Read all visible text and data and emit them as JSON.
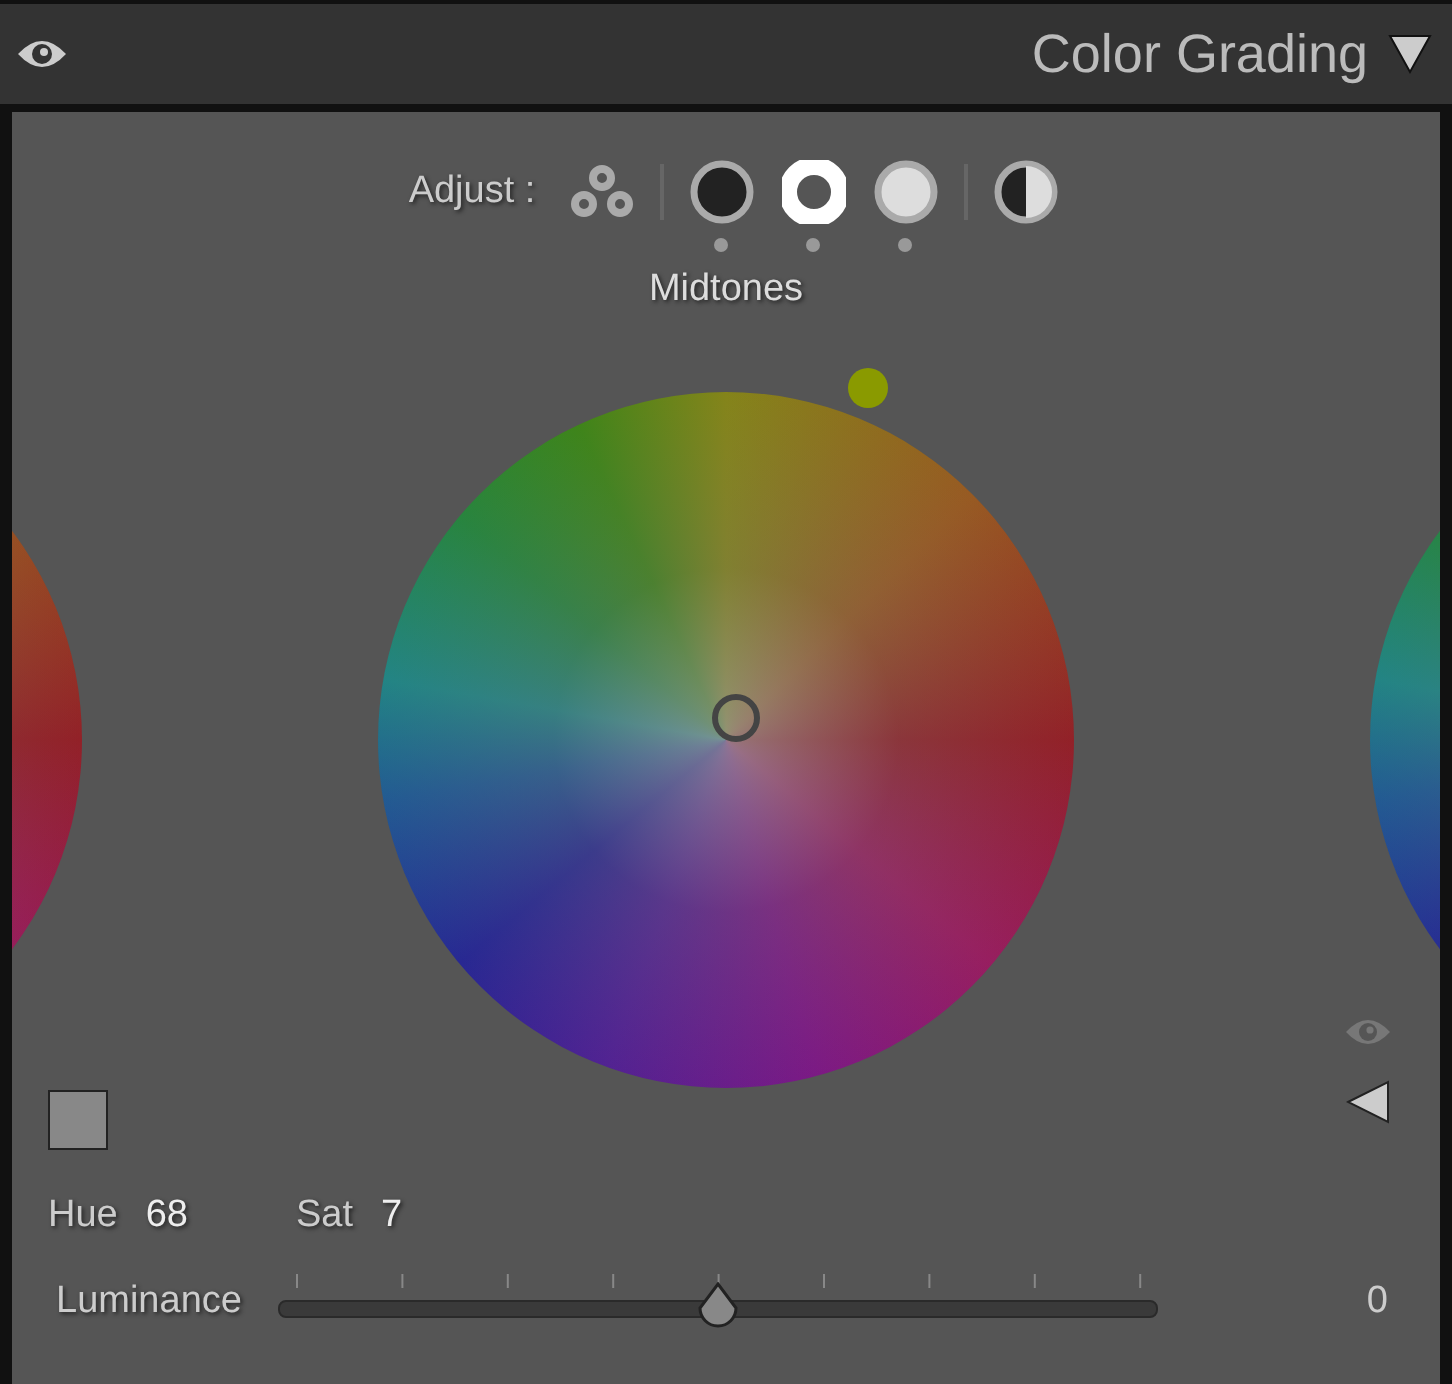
{
  "panel": {
    "title": "Color Grading",
    "expanded": true
  },
  "adjust": {
    "label": "Adjust :",
    "modes": [
      {
        "kind": "all",
        "selected": false
      },
      {
        "kind": "shadows",
        "selected": false
      },
      {
        "kind": "midtones",
        "selected": true
      },
      {
        "kind": "highlights",
        "selected": false
      },
      {
        "kind": "global",
        "selected": false
      }
    ]
  },
  "mode_label": "Midtones",
  "hue": {
    "label": "Hue",
    "value": "68"
  },
  "sat": {
    "label": "Sat",
    "value": "7"
  },
  "luminance": {
    "label": "Luminance",
    "level": 0.5,
    "reading": "0"
  }
}
